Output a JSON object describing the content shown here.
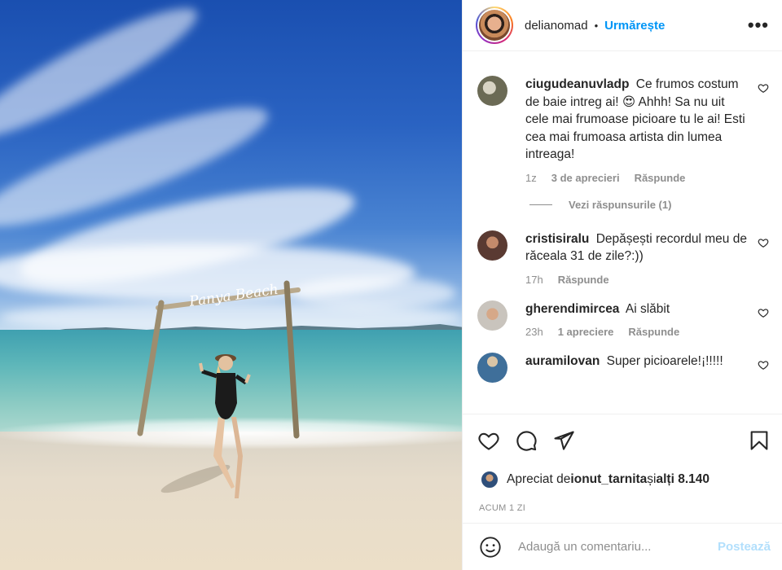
{
  "photo": {
    "alt_sign_text": "Panya Beach"
  },
  "header": {
    "username": "delianomad",
    "separator": "•",
    "follow_label": "Urmărește",
    "more_label": "•••"
  },
  "comments": [
    {
      "username": "ciugudeanuvladp",
      "text": "Ce frumos costum de baie intreg ai! 😍 Ahhh! Sa nu uit cele mai frumoase picioare tu le ai! Esti cea mai frumoasa artista din lumea intreaga!",
      "age": "1z",
      "likes": "3 de aprecieri",
      "reply_label": "Răspunde",
      "avatar_color": "#6b6a55"
    },
    {
      "username": "cristisiralu",
      "text": "Depășești recordul meu de răceala 31 de zile?:))",
      "age": "17h",
      "likes": "",
      "reply_label": "Răspunde",
      "avatar_color": "#5a3a32"
    },
    {
      "username": "gherendimircea",
      "text": "Ai slăbit",
      "age": "23h",
      "likes": "1 apreciere",
      "reply_label": "Răspunde",
      "avatar_color": "#c9c4bd"
    },
    {
      "username": "auramilovan",
      "text": "Super picioarele!¡!!!!!",
      "age": "",
      "likes": "",
      "reply_label": "",
      "avatar_color": "#3f6f9a"
    }
  ],
  "view_replies": "Vezi răspunsurile (1)",
  "likes_line": {
    "prefix": "Apreciat de ",
    "user": "ionut_tarnita",
    "middle": " și ",
    "others": "alți 8.140"
  },
  "timestamp": "ACUM 1 ZI",
  "add_comment": {
    "placeholder": "Adaugă un comentariu...",
    "post_label": "Postează"
  },
  "colors": {
    "accent": "#0095f6",
    "post_disabled": "#b2dffc",
    "muted": "#8e8e8e"
  }
}
